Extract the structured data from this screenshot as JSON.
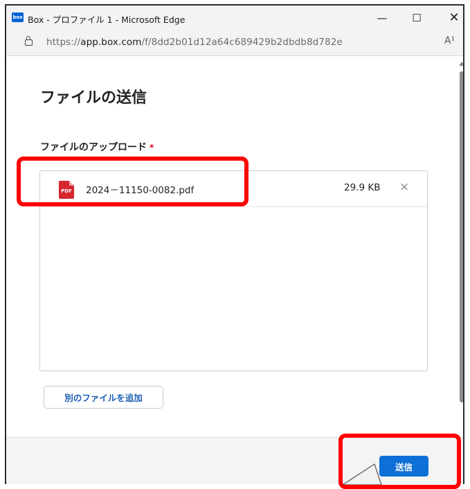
{
  "window": {
    "logo_text": "box",
    "title": "Box - プロファイル 1 - Microsoft Edge",
    "controls": {
      "minimize": "—",
      "maximize": "☐",
      "close": "✕"
    }
  },
  "address_bar": {
    "scheme": "https://",
    "host": "app.box.com",
    "path": "/f/8dd2b01d12a64c689429b2dbdb8d782e",
    "read_aloud_icon": "A¹"
  },
  "dialog": {
    "title": "ファイルの送信",
    "upload_label": "ファイルのアップロード",
    "required_mark": "*",
    "files": [
      {
        "icon": "pdf-file-icon",
        "icon_text": "PDF",
        "name": "2024－11150-0082.pdf",
        "size": "29.9 KB",
        "remove": "×"
      }
    ],
    "add_file_button": "別のファイルを追加",
    "send_button": "送信"
  },
  "annotations": {
    "highlight_color": "#ff0000",
    "highlights": [
      "uploaded-file-row",
      "send-button"
    ]
  },
  "colors": {
    "accent": "#0e6fd6",
    "link": "#1a5fb4",
    "pdf": "#d62630",
    "required": "#d9001b"
  }
}
